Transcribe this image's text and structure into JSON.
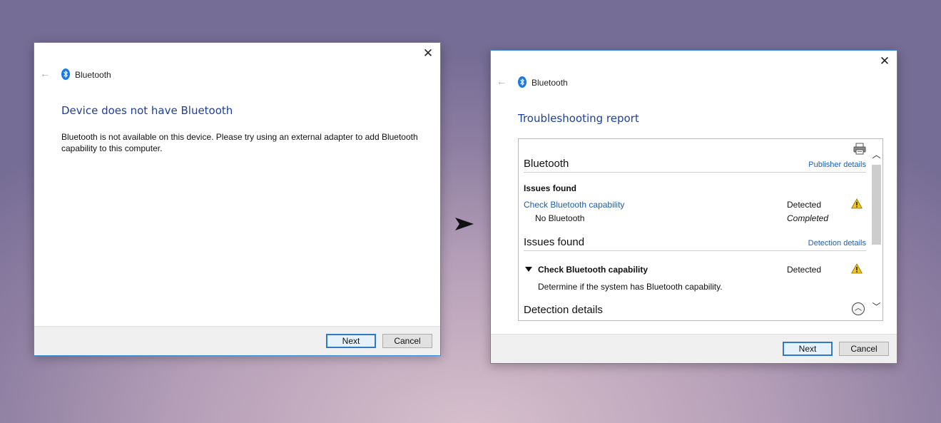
{
  "window1": {
    "app_title": "Bluetooth",
    "close_glyph": "✕",
    "back_glyph": "←",
    "heading": "Device does not have Bluetooth",
    "body": "Bluetooth is not available on this device. Please try using an external adapter to add Bluetooth capability to this computer.",
    "next_label": "Next",
    "cancel_label": "Cancel"
  },
  "window2": {
    "app_title": "Bluetooth",
    "close_glyph": "✕",
    "back_glyph": "←",
    "heading": "Troubleshooting report",
    "report": {
      "section1": {
        "title": "Bluetooth",
        "link": "Publisher details"
      },
      "issues_found_label": "Issues found",
      "issue_link": "Check Bluetooth capability",
      "issue_status": "Detected",
      "sub_issue": "No Bluetooth",
      "sub_status": "Completed",
      "section2": {
        "title": "Issues found",
        "link": "Detection details"
      },
      "detail_title": "Check Bluetooth capability",
      "detail_status": "Detected",
      "detail_desc": "Determine if the system has Bluetooth capability.",
      "section3": {
        "title": "Detection details"
      }
    },
    "next_label": "Next",
    "cancel_label": "Cancel"
  },
  "icons": {
    "bluetooth": "bluetooth-icon",
    "warning": "warning-icon",
    "printer": "printer-icon",
    "arrow": "arrow-right-icon"
  },
  "colors": {
    "accent": "#3c8fd6",
    "heading": "#1e3f9a",
    "link": "#1a5fb4",
    "warning": "#f2c318"
  }
}
